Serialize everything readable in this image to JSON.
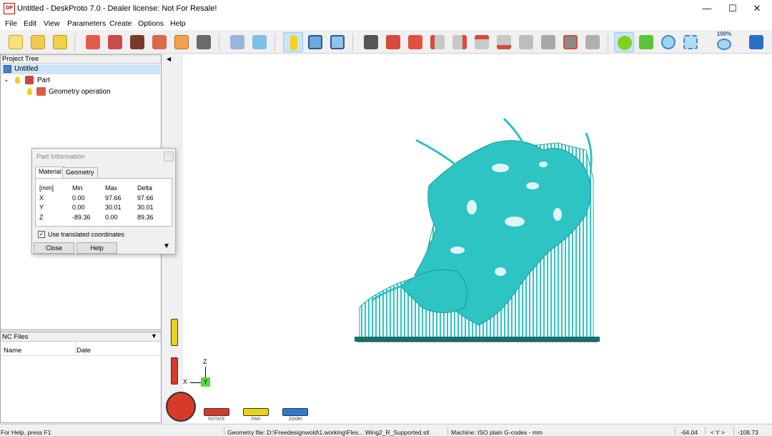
{
  "window": {
    "title": "Untitled - DeskProto 7.0 - Dealer license: Not For Resale!",
    "app_icon_text": "DP",
    "minimize_glyph": "—",
    "maximize_glyph": "☐",
    "close_glyph": "✕"
  },
  "menu": [
    "File",
    "Edit",
    "View",
    "Parameters",
    "Create",
    "Options",
    "Help"
  ],
  "toolbar": {
    "icons": [
      "new-project-icon",
      "open-project-icon",
      "save-project-icon",
      "import-geometry-icon",
      "edit-part-icon",
      "bitmap-icon",
      "vector-icon",
      "drawing-icon",
      "export-icon",
      "part-properties-icon",
      "find-icon",
      "info-icon",
      "layout-icon",
      "view-panel-icon",
      "camera-icon",
      "view-front-icon",
      "view-back-icon",
      "view-left-icon",
      "view-right-icon",
      "view-top-icon",
      "view-bottom-icon",
      "view-iso-1-icon",
      "view-iso-2-icon",
      "snapshot-icon",
      "snapshot-compare-icon",
      "rotate-icon",
      "pan-icon",
      "zoom-icon",
      "zoom-window-icon",
      "zoom-100-icon",
      "help-book-icon"
    ],
    "zoom_label": "100%",
    "active_icons": [
      "info-icon",
      "rotate-icon"
    ]
  },
  "project_tree": {
    "header": "Project Tree",
    "root": "Untitled",
    "part": "Part",
    "operation": "Geometry operation"
  },
  "nc_files": {
    "header": "NC Files",
    "columns": [
      "Name",
      "Date"
    ]
  },
  "part_info": {
    "title": "Part Information",
    "tabs": [
      "Material",
      "Geometry"
    ],
    "headers": [
      "[mm]",
      "Min",
      "Max",
      "Delta"
    ],
    "rows": [
      [
        "X",
        "0.00",
        "97.66",
        "97.66"
      ],
      [
        "Y",
        "0.00",
        "30.01",
        "30.01"
      ],
      [
        "Z",
        "-89.36",
        "0.00",
        "89.36"
      ]
    ],
    "checkbox_label": "Use translated coordinates",
    "checkbox_checked": true,
    "close_button": "Close",
    "help_button": "Help"
  },
  "viewport": {
    "model_color": "#2ec4c4",
    "axis_z": "Z",
    "axis_x": "X",
    "axis_y": "Y",
    "controls": [
      "ROTATE",
      "PAN",
      "ZOOM"
    ],
    "control_colors": [
      "#d83a2a",
      "#e8d51a",
      "#2a7bd8"
    ]
  },
  "statusbar": {
    "help": "For Help, press F1",
    "geometry_file": "Geometry file: D:\\Freedesignwold\\1.working\\Fles... Wing2_R_Supported.stl",
    "machine": "Machine: ISO plain G-codes - mm",
    "coord_x": "-64.04",
    "coord_axis": "< Y >",
    "coord_y": "-108.73"
  }
}
